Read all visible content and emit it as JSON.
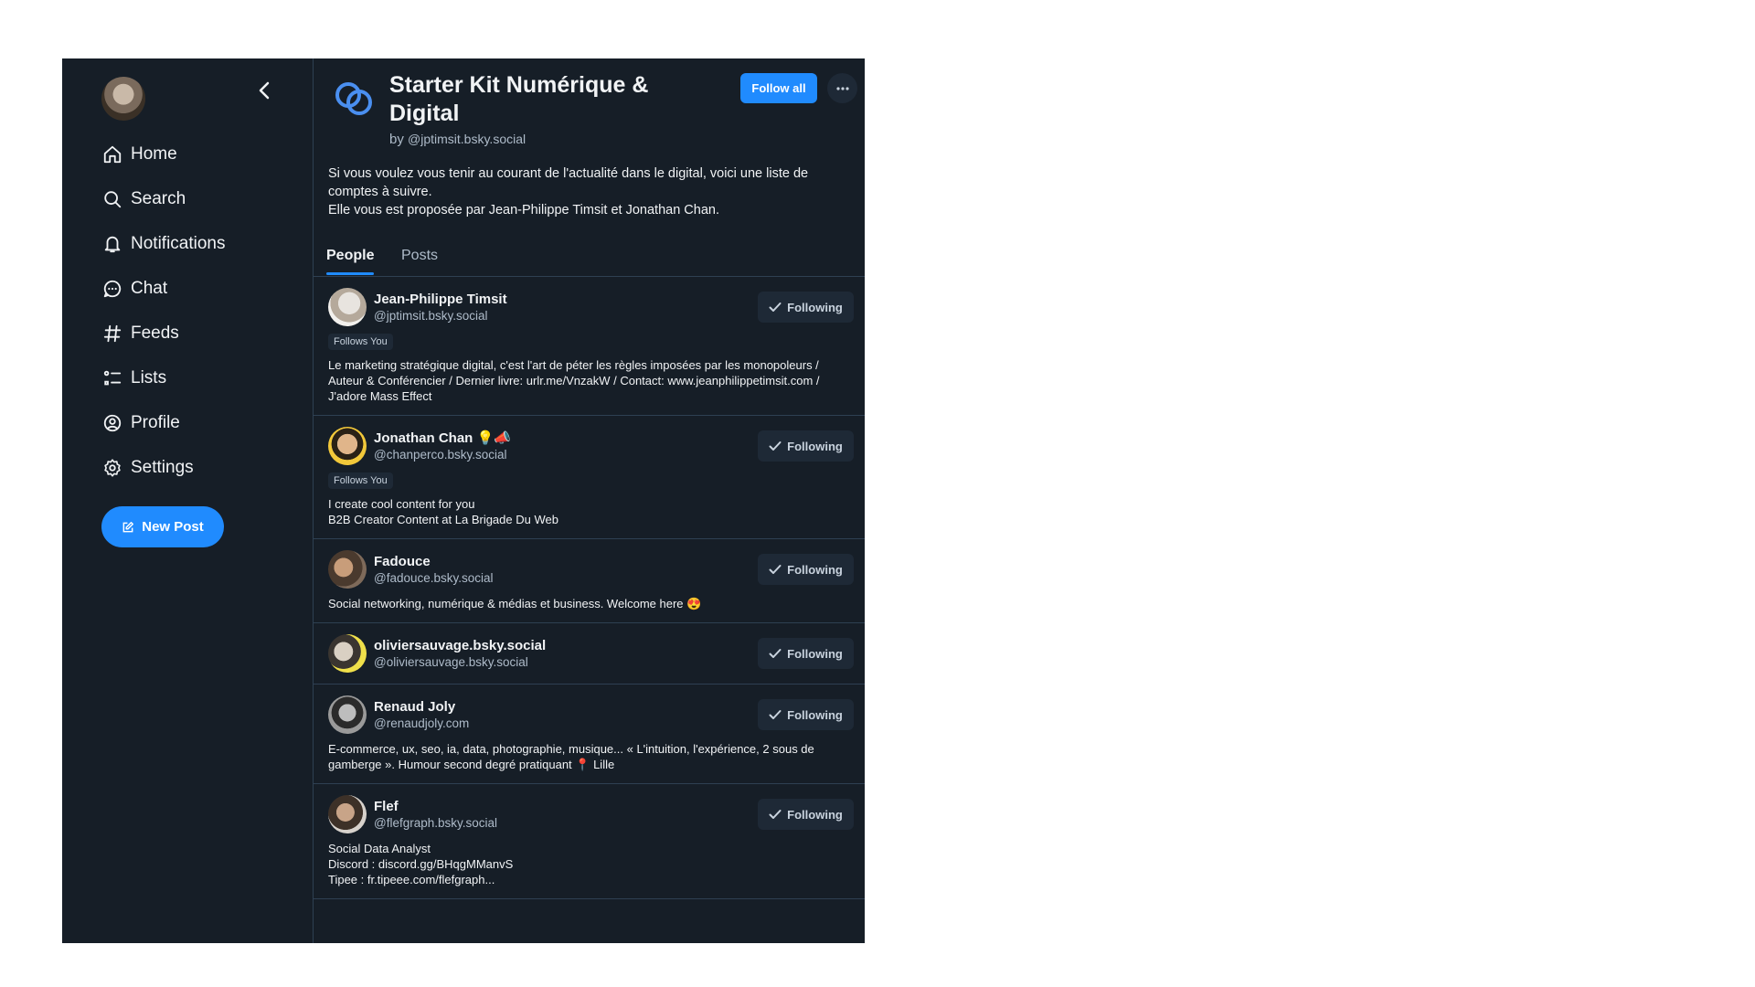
{
  "sidebar": {
    "items": [
      {
        "label": "Home",
        "icon": "home-icon"
      },
      {
        "label": "Search",
        "icon": "search-icon"
      },
      {
        "label": "Notifications",
        "icon": "bell-icon"
      },
      {
        "label": "Chat",
        "icon": "chat-icon"
      },
      {
        "label": "Feeds",
        "icon": "hash-icon"
      },
      {
        "label": "Lists",
        "icon": "list-icon"
      },
      {
        "label": "Profile",
        "icon": "profile-icon"
      },
      {
        "label": "Settings",
        "icon": "gear-icon"
      }
    ],
    "new_post_label": "New Post"
  },
  "header": {
    "title": "Starter Kit Numérique & Digital",
    "by_prefix": "by",
    "by_handle": "@jptimsit.bsky.social",
    "follow_all_label": "Follow all",
    "description_line1": "Si vous voulez vous tenir au courant de l'actualité dans le digital, voici une liste de comptes à suivre.",
    "description_line2": "Elle vous est proposée par Jean-Philippe Timsit et Jonathan Chan."
  },
  "tabs": [
    {
      "label": "People"
    },
    {
      "label": "Posts"
    }
  ],
  "colors": {
    "accent": "#208bfe",
    "background": "#161e27",
    "border": "#2e4052"
  },
  "people": [
    {
      "name": "Jean-Philippe Timsit",
      "handle": "@jptimsit.bsky.social",
      "follows_you": "Follows You",
      "bio": "Le marketing stratégique digital, c'est l'art de péter les règles imposées par les monopoleurs / Auteur & Conférencier / Dernier livre: urlr.me/VnzakW / Contact: www.jeanphilippetimsit.com / J'adore Mass Effect",
      "button": "Following"
    },
    {
      "name": "Jonathan Chan 💡📣",
      "handle": "@chanperco.bsky.social",
      "follows_you": "Follows You",
      "bio_line1": "I create cool content for you",
      "bio_line2": "B2B Creator Content at La Brigade Du Web",
      "button": "Following"
    },
    {
      "name": "Fadouce",
      "handle": "@fadouce.bsky.social",
      "bio": "Social networking, numérique & médias et business. Welcome here 😍",
      "button": "Following"
    },
    {
      "name": "oliviersauvage.bsky.social",
      "handle": "@oliviersauvage.bsky.social",
      "button": "Following"
    },
    {
      "name": "Renaud Joly",
      "handle": "@renaudjoly.com",
      "bio": "E-commerce, ux, seo, ia, data, photographie, musique... « L'intuition, l'expérience, 2 sous de gamberge ». Humour second degré pratiquant 📍 Lille",
      "button": "Following"
    },
    {
      "name": "Flef",
      "handle": "@flefgraph.bsky.social",
      "bio_line1": "Social Data Analyst",
      "bio_line2": "Discord : discord.gg/BHqgMManvS",
      "bio_line3": "Tipee : fr.tipeee.com/flefgraph...",
      "button": "Following"
    }
  ]
}
